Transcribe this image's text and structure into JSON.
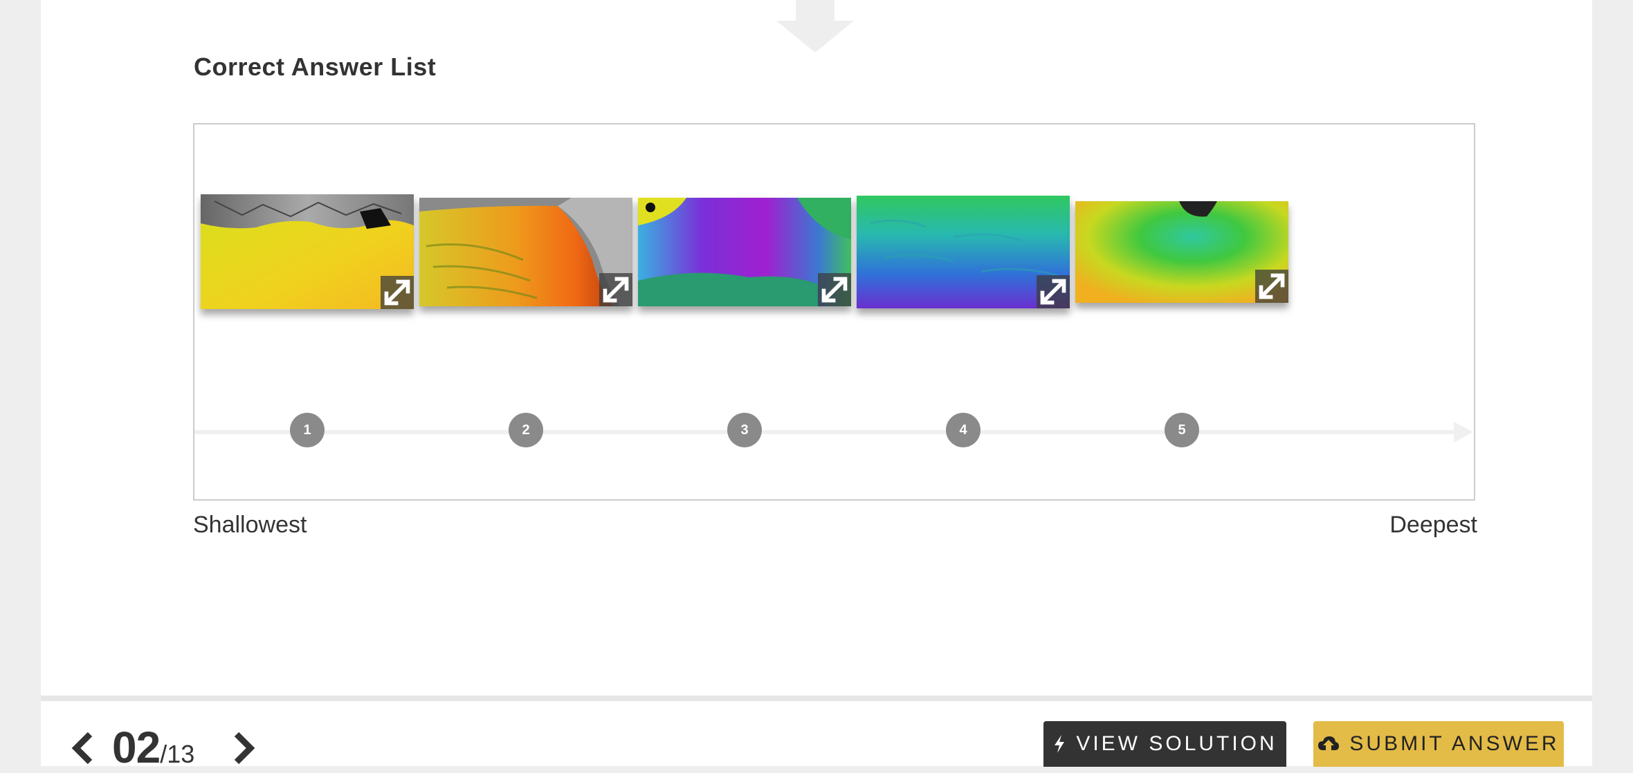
{
  "title": "Correct Answer List",
  "scale": {
    "left_label": "Shallowest",
    "right_label": "Deepest"
  },
  "items": [
    {
      "rank": "1",
      "image_icon": "bathymetry-map-yellow"
    },
    {
      "rank": "2",
      "image_icon": "bathymetry-map-orange"
    },
    {
      "rank": "3",
      "image_icon": "bathymetry-map-purple"
    },
    {
      "rank": "4",
      "image_icon": "bathymetry-map-blue"
    },
    {
      "rank": "5",
      "image_icon": "bathymetry-map-green"
    }
  ],
  "pagination": {
    "current": "02",
    "total": "/13"
  },
  "buttons": {
    "view_solution": "VIEW SOLUTION",
    "submit_answer": "SUBMIT ANSWER"
  },
  "colors": {
    "submit": "#e3bb47",
    "solution": "#333333",
    "marker": "#8a8a8a"
  }
}
